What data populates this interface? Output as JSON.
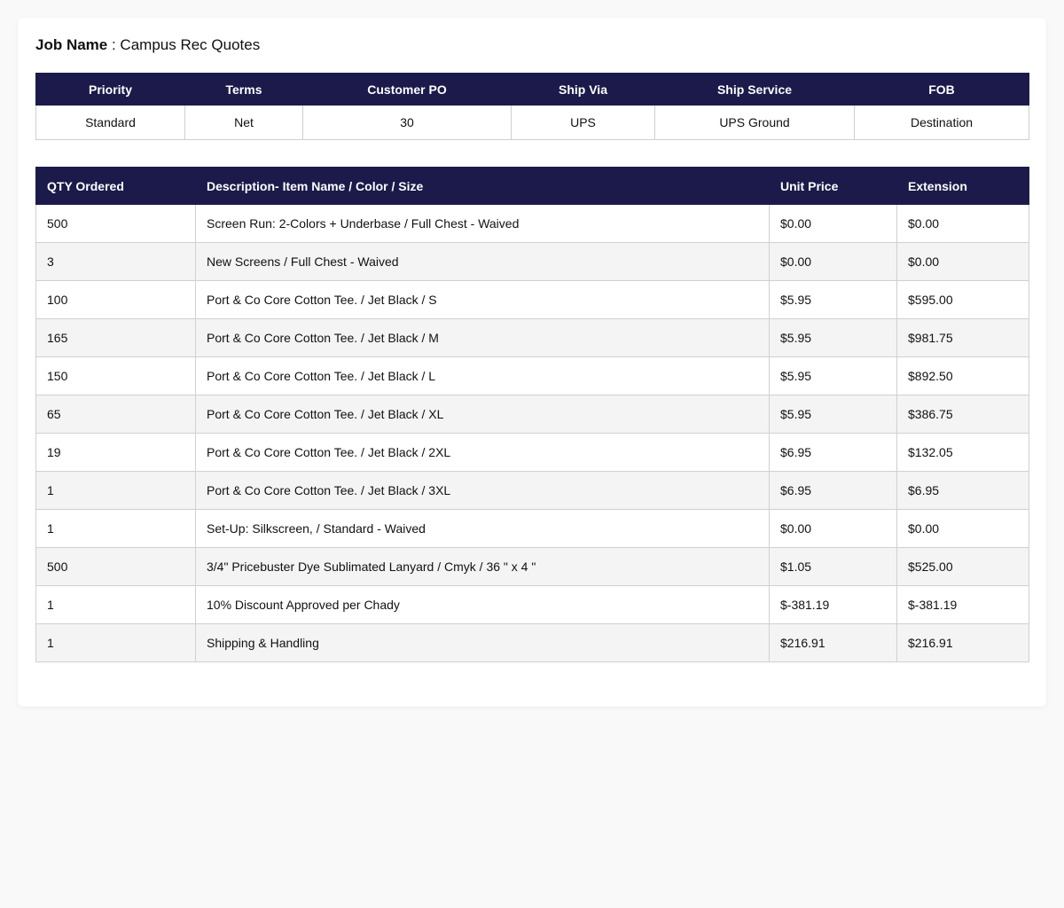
{
  "job": {
    "label": "Job Name",
    "separator": " : ",
    "value": "Campus Rec Quotes"
  },
  "order_info": {
    "headers": [
      "Priority",
      "Terms",
      "Customer PO",
      "Ship Via",
      "Ship Service",
      "FOB"
    ],
    "values": [
      "Standard",
      "Net",
      "30",
      "UPS",
      "UPS Ground",
      "Destination"
    ]
  },
  "line_items": {
    "headers": [
      "QTY Ordered",
      "Description- Item Name / Color / Size",
      "Unit Price",
      "Extension"
    ],
    "rows": [
      [
        "500",
        "Screen Run: 2-Colors + Underbase / Full Chest - Waived",
        "$0.00",
        "$0.00"
      ],
      [
        "3",
        "New Screens / Full Chest - Waived",
        "$0.00",
        "$0.00"
      ],
      [
        "100",
        "Port & Co Core Cotton Tee. / Jet Black / S",
        "$5.95",
        "$595.00"
      ],
      [
        "165",
        "Port & Co Core Cotton Tee. / Jet Black / M",
        "$5.95",
        "$981.75"
      ],
      [
        "150",
        "Port & Co Core Cotton Tee. / Jet Black / L",
        "$5.95",
        "$892.50"
      ],
      [
        "65",
        "Port & Co Core Cotton Tee. / Jet Black / XL",
        "$5.95",
        "$386.75"
      ],
      [
        "19",
        "Port & Co Core Cotton Tee. / Jet Black / 2XL",
        "$6.95",
        "$132.05"
      ],
      [
        "1",
        "Port & Co Core Cotton Tee. / Jet Black / 3XL",
        "$6.95",
        "$6.95"
      ],
      [
        "1",
        "Set-Up: Silkscreen, / Standard - Waived",
        "$0.00",
        "$0.00"
      ],
      [
        "500",
        "3/4\" Pricebuster Dye Sublimated Lanyard / Cmyk / 36 \" x 4 \"",
        "$1.05",
        "$525.00"
      ],
      [
        "1",
        "10% Discount Approved per Chady",
        "$-381.19",
        "$-381.19"
      ],
      [
        "1",
        "Shipping & Handling",
        "$216.91",
        "$216.91"
      ]
    ]
  },
  "colors": {
    "header_bg": "#1b1a4b",
    "page_bg": "#f9f9f9",
    "row_alt_bg": "#f4f4f4"
  }
}
